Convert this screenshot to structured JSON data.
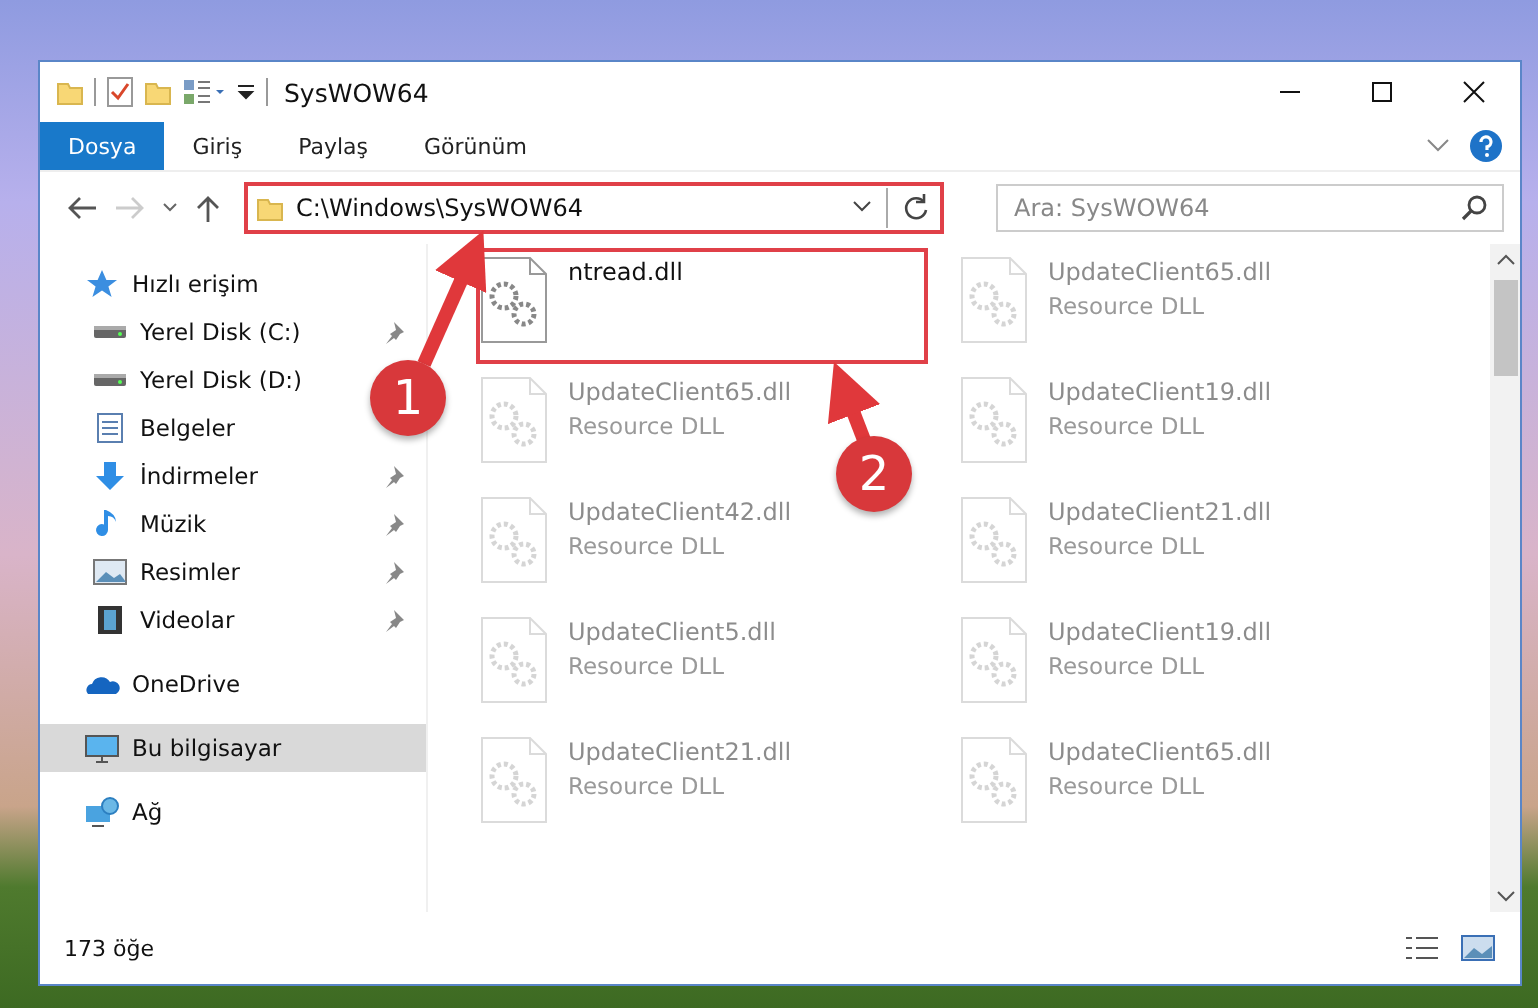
{
  "window": {
    "title": "SysWOW64"
  },
  "ribbon_tabs": [
    {
      "label": "Dosya",
      "selected": true
    },
    {
      "label": "Giriş",
      "selected": false
    },
    {
      "label": "Paylaş",
      "selected": false
    },
    {
      "label": "Görünüm",
      "selected": false
    }
  ],
  "address_bar": {
    "path": "C:\\Windows\\SysWOW64",
    "highlighted": true
  },
  "search": {
    "placeholder": "Ara: SysWOW64"
  },
  "sidebar": {
    "items": [
      {
        "label": "Hızlı erişim",
        "kind": "star",
        "selected": false,
        "children": [
          {
            "label": "Yerel Disk (C:)",
            "kind": "drive",
            "pinned": true,
            "selected": false
          },
          {
            "label": "Yerel Disk (D:)",
            "kind": "drive",
            "pinned": false,
            "selected": false
          },
          {
            "label": "Belgeler",
            "kind": "document",
            "pinned": false,
            "selected": false
          },
          {
            "label": "İndirmeler",
            "kind": "download",
            "pinned": true,
            "selected": false
          },
          {
            "label": "Müzik",
            "kind": "music",
            "pinned": true,
            "selected": false
          },
          {
            "label": "Resimler",
            "kind": "pictures",
            "pinned": true,
            "selected": false
          },
          {
            "label": "Videolar",
            "kind": "video",
            "pinned": true,
            "selected": false
          }
        ]
      },
      {
        "label": "OneDrive",
        "kind": "cloud",
        "selected": false
      },
      {
        "label": "Bu bilgisayar",
        "kind": "computer",
        "selected": true
      },
      {
        "label": "Ağ",
        "kind": "network",
        "selected": false
      }
    ]
  },
  "files": [
    {
      "name": "ntread.dll",
      "faded": false,
      "highlighted": true
    },
    {
      "name": "UpdateClient65.dll",
      "type": "Resource DLL",
      "faded": true,
      "highlighted": false
    },
    {
      "name": "UpdateClient65.dll",
      "type": "Resource DLL",
      "faded": true,
      "highlighted": false
    },
    {
      "name": "UpdateClient19.dll",
      "type": "Resource DLL",
      "faded": true,
      "highlighted": false
    },
    {
      "name": "UpdateClient42.dll",
      "type": "Resource DLL",
      "faded": true,
      "highlighted": false
    },
    {
      "name": "UpdateClient21.dll",
      "type": "Resource DLL",
      "faded": true,
      "highlighted": false
    },
    {
      "name": "UpdateClient5.dll",
      "type": "Resource DLL",
      "faded": true,
      "highlighted": false
    },
    {
      "name": "UpdateClient19.dll",
      "type": "Resource DLL",
      "faded": true,
      "highlighted": false
    },
    {
      "name": "UpdateClient21.dll",
      "type": "Resource DLL",
      "faded": true,
      "highlighted": false
    },
    {
      "name": "UpdateClient65.dll",
      "type": "Resource DLL",
      "faded": true,
      "highlighted": false
    }
  ],
  "status_bar": {
    "item_count": "173 öğe"
  },
  "annotations": [
    {
      "label": "1"
    },
    {
      "label": "2"
    }
  ]
}
